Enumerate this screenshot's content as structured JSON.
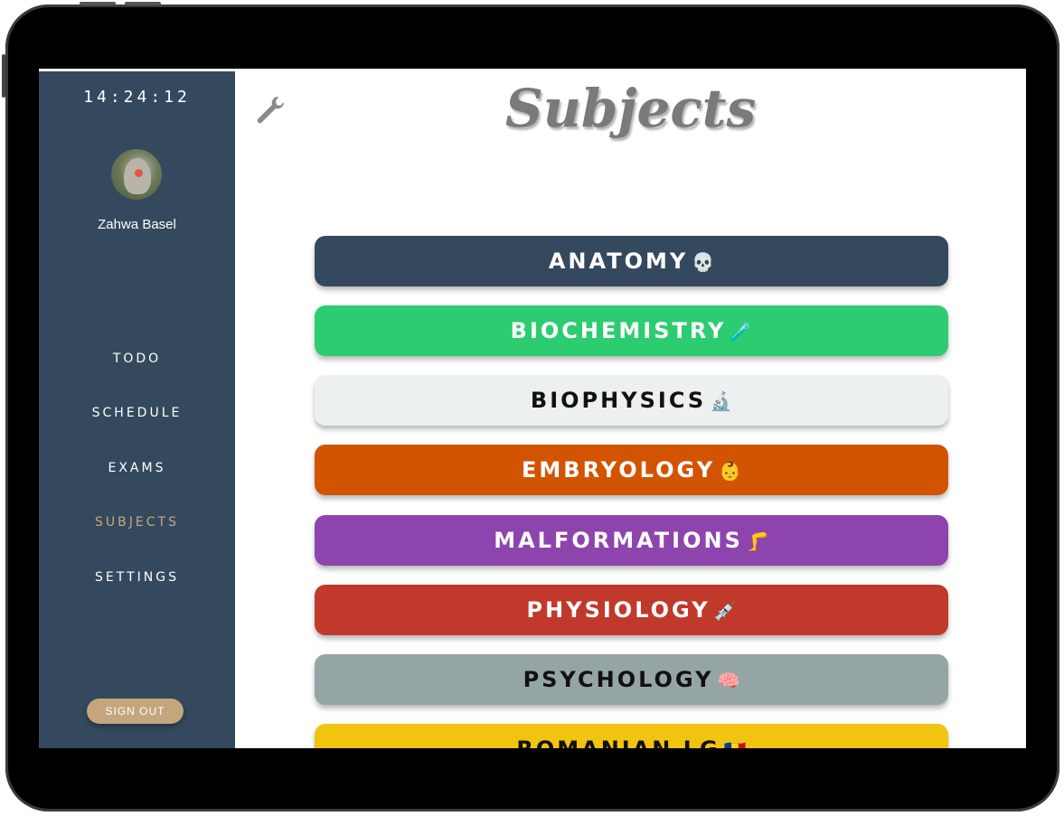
{
  "sidebar": {
    "clock": "14:24:12",
    "user_name": "Zahwa Basel",
    "nav": [
      {
        "label": "TODO",
        "active": false
      },
      {
        "label": "SCHEDULE",
        "active": false
      },
      {
        "label": "EXAMS",
        "active": false
      },
      {
        "label": "SUBJECTS",
        "active": true
      },
      {
        "label": "SETTINGS",
        "active": false
      }
    ],
    "sign_out": "SIGN OUT"
  },
  "main": {
    "title": "Subjects",
    "settings_icon": "wrench-icon",
    "subjects": [
      {
        "name": "ANATOMY",
        "emoji": "💀",
        "color": "#34495e",
        "text_color": "#ffffff"
      },
      {
        "name": "BIOCHEMISTRY",
        "emoji": "🧪",
        "color": "#2ecc71",
        "text_color": "#ffffff"
      },
      {
        "name": "BIOPHYSICS",
        "emoji": "🔬",
        "color": "#ecf0f1",
        "text_color": "#111111"
      },
      {
        "name": "EMBRYOLOGY",
        "emoji": "👶",
        "color": "#d35400",
        "text_color": "#ffffff"
      },
      {
        "name": "MALFORMATIONS",
        "emoji": "🦵",
        "color": "#8e44ad",
        "text_color": "#ffffff"
      },
      {
        "name": "PHYSIOLOGY",
        "emoji": "💉",
        "color": "#c0392b",
        "text_color": "#ffffff"
      },
      {
        "name": "PSYCHOLOGY",
        "emoji": "🧠",
        "color": "#95a5a6",
        "text_color": "#111111"
      },
      {
        "name": "ROMANIAN LG",
        "emoji": "🇷🇴",
        "color": "#f1c40f",
        "text_color": "#111111"
      }
    ]
  },
  "colors": {
    "sidebar_bg": "#34495e",
    "accent": "#c9a87c",
    "sign_out_bg": "#c4a57d"
  }
}
